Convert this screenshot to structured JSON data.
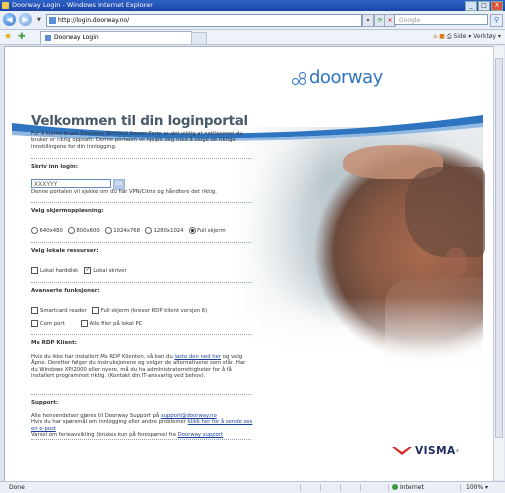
{
  "window": {
    "title": "Doorway Login - Windows Internet Explorer",
    "controls": [
      "_",
      "□",
      "X"
    ]
  },
  "navbar": {
    "address": "http://login.doorway.no/",
    "search_placeholder": "Google"
  },
  "tabs": {
    "active_tab": "Doorway Login"
  },
  "toolbar": {
    "tools_text": "Side ▾  Verktøy ▾"
  },
  "page": {
    "logo_text": "doorway",
    "heading": "Velkommen til din loginportal",
    "intro": "For å kunne bruke Doorway Terminal Server Farm er det viktig at nettleseren du bruker er riktig oppsatt. Denne portalen vil hjelpe deg med å velge de riktige innstillingene for din innlogging.",
    "login_section": {
      "label": "Skriv inn login:",
      "input_value": "XXXYYY",
      "go_label": "OK",
      "note": "Denne portalen vil sjekke om du har VPN/Citrix og håndtere det riktig."
    },
    "resolution_section": {
      "label": "Velg skjermoppløsning:",
      "options": [
        "640x480",
        "800x600",
        "1024x768",
        "1280x1024",
        "Full skjerm"
      ],
      "selected_index": 4
    },
    "resources_section": {
      "label": "Velg lokale ressurser:",
      "options": [
        {
          "label": "Lokal harddisk",
          "checked": false
        },
        {
          "label": "Lokal skriver",
          "checked": true
        }
      ]
    },
    "advanced_section": {
      "label": "Avanserte funksjoner:",
      "options": [
        {
          "label": "Smartcard reader",
          "checked": false
        },
        {
          "label": "Full skjerm (krever RDP klient versjon 6)",
          "checked": false
        },
        {
          "label": "Com port",
          "checked": false
        },
        {
          "label": "Alle filer på lokal PC",
          "checked": false
        }
      ]
    },
    "rdp_section": {
      "label": "Ms RDP Klient:",
      "text_before_link": "Hvis du ikke har installert Ms RDP Klienten, så kan du",
      "link": "laste den ned her",
      "text_after_link": "og velg Åpne. Deretter følger du instruksjonene og velger de alternativene som står. Har du Windows XP/2000 eller nyere, må du ha administratorrettigheter for å få installert programmet riktig. (Kontakt din IT-ansvarlig ved behov)."
    },
    "support_section": {
      "label": "Support:",
      "line1_before": "Alle henvendelser gjøres til Doorway Support på",
      "line1_link": "support@doorway.no",
      "line2_before": "Hvis du har spørsmål om innlogging eller andre problemer",
      "line2_link": "klikk her for å sende oss en e-post",
      "line3_before": "Varsel om ferieavvikling (brukes kun på forespørsel fra",
      "line3_link": "Doorway support"
    },
    "footer_logo": "VISMA",
    "footer_logo_mark": "®"
  },
  "statusbar": {
    "status": "Done",
    "zone": "Internet",
    "zoom": "100% ▾"
  },
  "colors": {
    "brand_blue": "#2f74c0",
    "heading_gray": "#4a5a6a",
    "visma_red": "#d6261c",
    "visma_navy": "#1d2b5c",
    "link_blue": "#1a3f9a"
  }
}
